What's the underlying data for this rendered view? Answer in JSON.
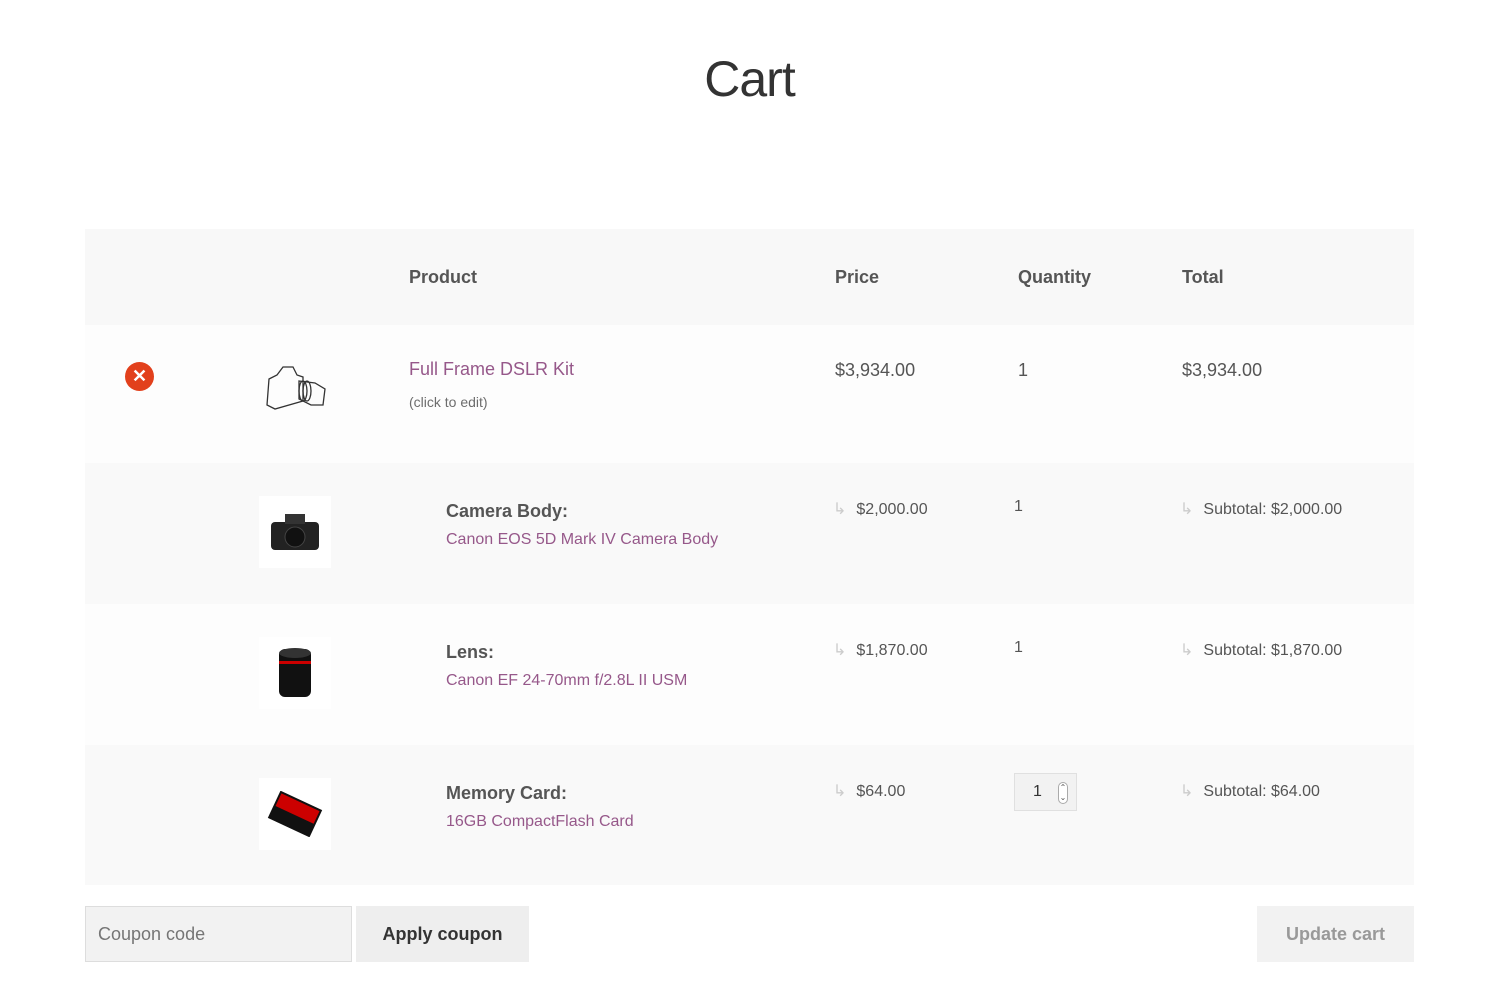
{
  "page": {
    "title": "Cart"
  },
  "table": {
    "headers": {
      "product": "Product",
      "price": "Price",
      "quantity": "Quantity",
      "total": "Total"
    }
  },
  "kit": {
    "name": "Full Frame DSLR Kit",
    "edit": "(click to edit)",
    "price": "$3,934.00",
    "quantity": "1",
    "total": "$3,934.00"
  },
  "components": [
    {
      "label": "Camera Body:",
      "name": "Canon EOS 5D Mark IV Camera Body",
      "price": "$2,000.00",
      "quantity": "1",
      "subtotal": "Subtotal: $2,000.00"
    },
    {
      "label": "Lens:",
      "name": "Canon EF 24-70mm f/2.8L II USM",
      "price": "$1,870.00",
      "quantity": "1",
      "subtotal": "Subtotal: $1,870.00"
    },
    {
      "label": "Memory Card:",
      "name": "16GB CompactFlash Card",
      "price": "$64.00",
      "quantity": "1",
      "subtotal": "Subtotal: $64.00"
    }
  ],
  "actions": {
    "coupon_placeholder": "Coupon code",
    "apply": "Apply coupon",
    "update": "Update cart"
  },
  "colors": {
    "link": "#96588a",
    "remove": "#e2401c"
  }
}
